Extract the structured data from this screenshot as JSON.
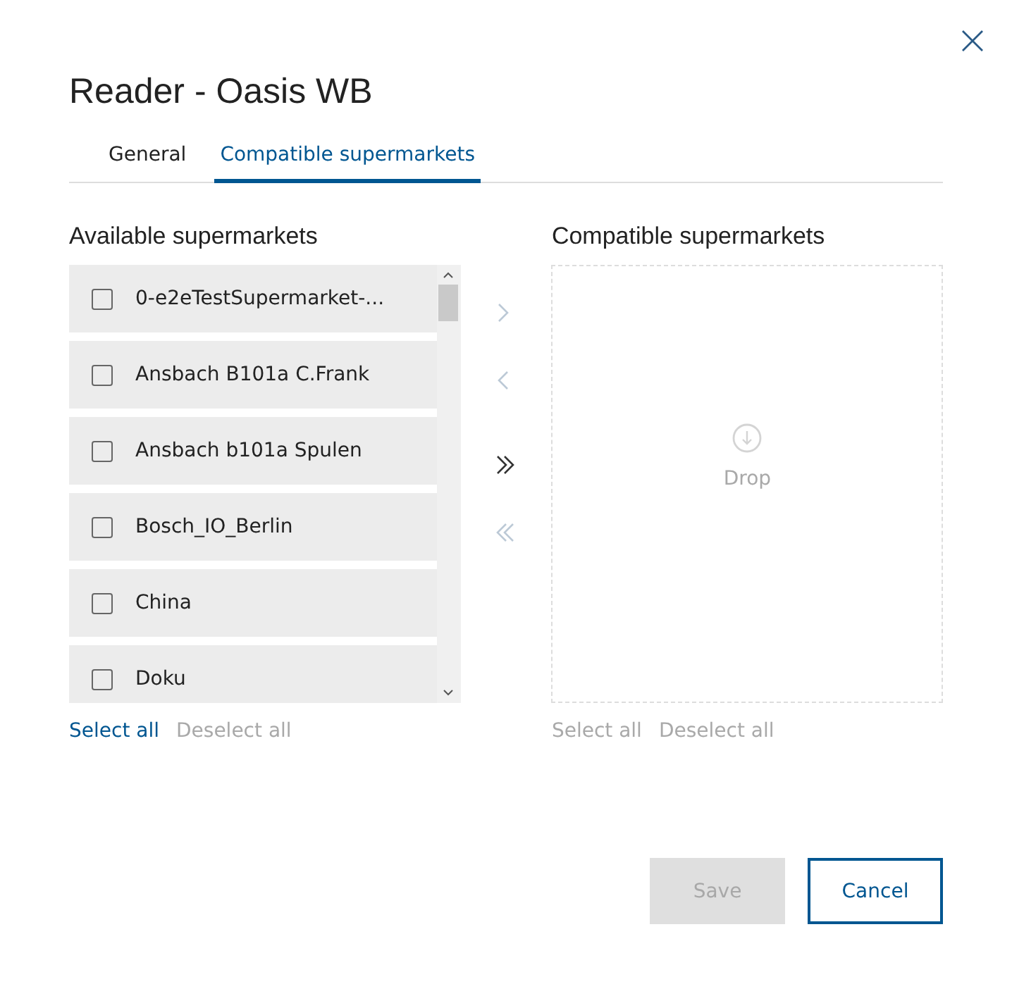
{
  "dialog": {
    "title": "Reader - Oasis WB"
  },
  "tabs": [
    {
      "label": "General",
      "selected": false
    },
    {
      "label": "Compatible supermarkets",
      "selected": true
    }
  ],
  "available": {
    "heading": "Available supermarkets",
    "items": [
      {
        "label": "0-e2eTestSupermarket-...",
        "checked": false
      },
      {
        "label": "Ansbach B101a C.Frank",
        "checked": false
      },
      {
        "label": "Ansbach b101a Spulen",
        "checked": false
      },
      {
        "label": "Bosch_IO_Berlin",
        "checked": false
      },
      {
        "label": "China",
        "checked": false
      },
      {
        "label": "Doku",
        "checked": false
      }
    ],
    "actions": [
      {
        "label": "Select all",
        "disabled": false
      },
      {
        "label": "Deselect all",
        "disabled": true
      }
    ]
  },
  "transfer_buttons": [
    {
      "kind": "right",
      "disabled": true
    },
    {
      "kind": "left",
      "disabled": true
    },
    {
      "kind": "all-right",
      "disabled": false
    },
    {
      "kind": "all-left",
      "disabled": true
    }
  ],
  "compatible": {
    "heading": "Compatible supermarkets",
    "drop_label": "Drop",
    "actions": [
      {
        "label": "Select all",
        "disabled": true
      },
      {
        "label": "Deselect all",
        "disabled": true
      }
    ]
  },
  "buttons": [
    {
      "label": "Save",
      "kind": "primary",
      "disabled": true
    },
    {
      "label": "Cancel",
      "kind": "secondary",
      "disabled": false
    }
  ]
}
